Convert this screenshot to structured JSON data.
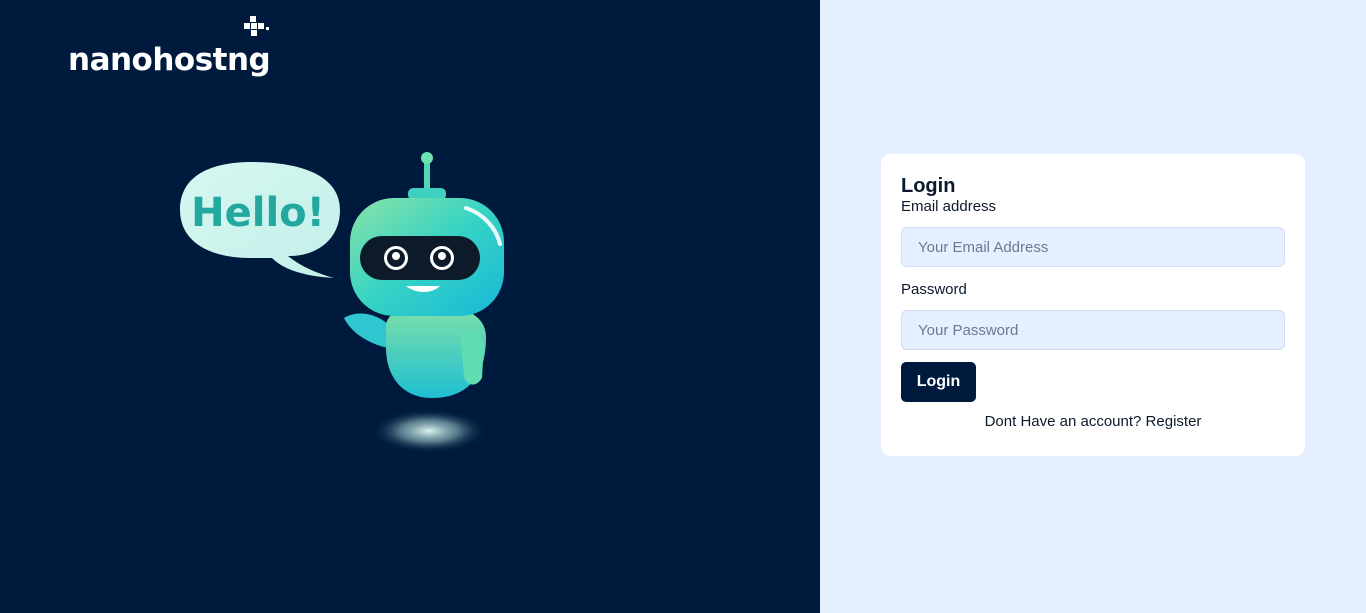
{
  "brand": {
    "logo_text": "nanohostng"
  },
  "illustration": {
    "bubble_text": "Hello!"
  },
  "login": {
    "title": "Login",
    "email_label": "Email address",
    "email_placeholder": "Your Email Address",
    "email_value": "",
    "password_label": "Password",
    "password_placeholder": "Your Password",
    "password_value": "",
    "submit_label": "Login",
    "register_prompt": "Dont Have an account?",
    "register_link": "Register"
  },
  "colors": {
    "left_bg": "#001a3d",
    "right_bg": "#e6efff",
    "button_bg": "#001a3d",
    "robot_teal": "#2ad1c4"
  }
}
